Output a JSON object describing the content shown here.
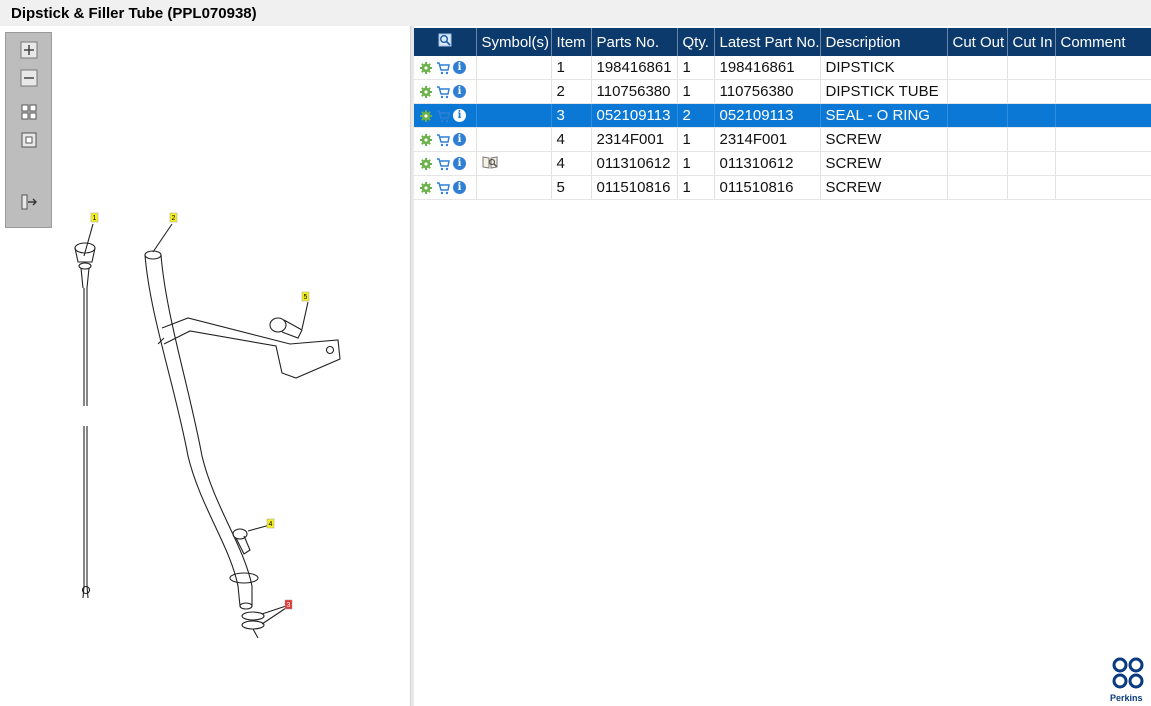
{
  "window": {
    "title": "Dipstick & Filler Tube (PPL070938)"
  },
  "toolbar": {
    "buttons": [
      {
        "name": "zoom-in-button",
        "icon": "zoom-in-icon"
      },
      {
        "name": "zoom-out-button",
        "icon": "zoom-out-icon"
      },
      {
        "name": "fit-all-button",
        "icon": "fit-all-icon"
      },
      {
        "name": "fit-window-button",
        "icon": "fit-window-icon"
      },
      {
        "name": "export-button",
        "icon": "export-arrow-icon"
      }
    ]
  },
  "diagram": {
    "callouts": [
      "1",
      "2",
      "5",
      "4",
      "3"
    ]
  },
  "grid": {
    "columns": [
      "",
      "Symbol(s)",
      "Item",
      "Parts No.",
      "Qty.",
      "Latest Part No.",
      "Description",
      "Cut Out",
      "Cut In",
      "Comment"
    ],
    "rows": [
      {
        "item": "1",
        "parts_no": "198416861",
        "qty": "1",
        "latest": "198416861",
        "description": "DIPSTICK",
        "symbol": ""
      },
      {
        "item": "2",
        "parts_no": "110756380",
        "qty": "1",
        "latest": "110756380",
        "description": "DIPSTICK TUBE",
        "symbol": ""
      },
      {
        "item": "3",
        "parts_no": "052109113",
        "qty": "2",
        "latest": "052109113",
        "description": "SEAL - O RING",
        "symbol": ""
      },
      {
        "item": "4",
        "parts_no": "2314F001",
        "qty": "1",
        "latest": "2314F001",
        "description": "SCREW",
        "symbol": ""
      },
      {
        "item": "4",
        "parts_no": "011310612",
        "qty": "1",
        "latest": "011310612",
        "description": "SCREW",
        "symbol": "book-search-icon"
      },
      {
        "item": "5",
        "parts_no": "011510816",
        "qty": "1",
        "latest": "011510816",
        "description": "SCREW",
        "symbol": ""
      }
    ],
    "selected_row_index": 2
  },
  "brand": {
    "name": "Perkins"
  },
  "colors": {
    "header": "#0c3a6d",
    "selected": "#0a78d4",
    "callout": "#f7f21e",
    "callout_selected": "#e53935",
    "brand": "#0b3c82"
  }
}
